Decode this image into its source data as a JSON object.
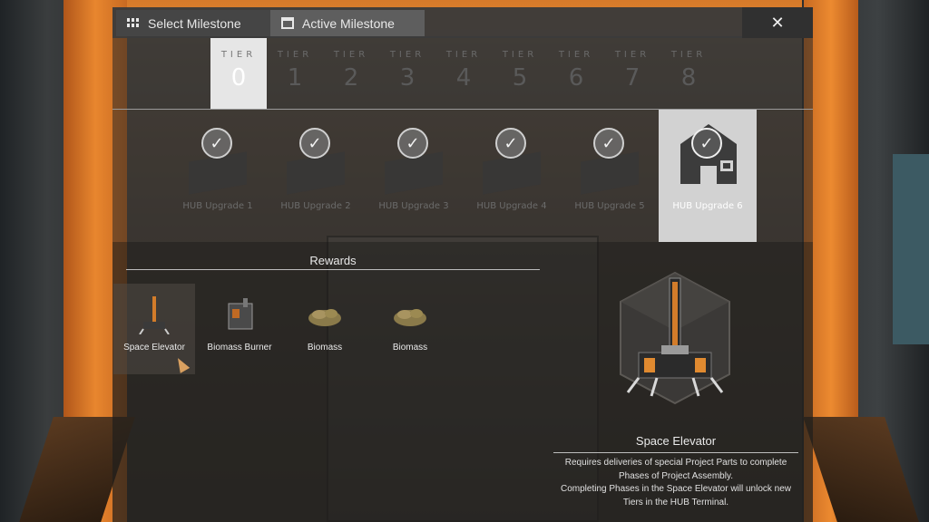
{
  "tabs": {
    "select_label": "Select Milestone",
    "active_label": "Active Milestone",
    "close_label": "✕"
  },
  "tiers": {
    "label": "TIER",
    "items": [
      "0",
      "1",
      "2",
      "3",
      "4",
      "5",
      "6",
      "7",
      "8"
    ],
    "selected_index": 0
  },
  "milestones": [
    {
      "label": "HUB Upgrade 1",
      "completed": true
    },
    {
      "label": "HUB Upgrade 2",
      "completed": true
    },
    {
      "label": "HUB Upgrade 3",
      "completed": true
    },
    {
      "label": "HUB Upgrade 4",
      "completed": true
    },
    {
      "label": "HUB Upgrade 5",
      "completed": true
    },
    {
      "label": "HUB Upgrade 6",
      "completed": true,
      "selected": true
    }
  ],
  "rewards": {
    "title": "Rewards",
    "items": [
      {
        "label": "Space Elevator",
        "icon": "space-elevator-icon"
      },
      {
        "label": "Biomass Burner",
        "icon": "biomass-burner-icon"
      },
      {
        "label": "Biomass",
        "icon": "biomass-icon"
      },
      {
        "label": "Biomass",
        "icon": "biomass-icon"
      }
    ]
  },
  "detail": {
    "title": "Space Elevator",
    "description": "Requires deliveries of special Project Parts to complete\nPhases of Project Assembly.\nCompleting Phases in the Space Elevator will unlock new\nTiers in the HUB Terminal."
  },
  "colors": {
    "accent_orange": "#e8862e",
    "selected_tile": "#e6e6e6",
    "panel_dark": "#3a3a3a"
  }
}
